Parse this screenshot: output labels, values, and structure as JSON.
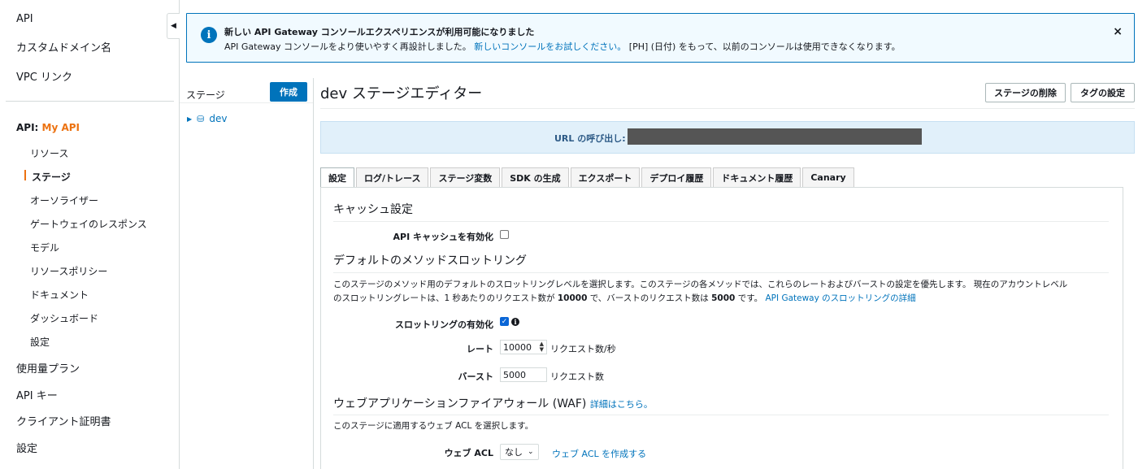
{
  "nav": {
    "top_items": [
      "API",
      "カスタムドメイン名",
      "VPC リンク"
    ],
    "api_prefix": "API: ",
    "api_name": "My API",
    "sub_items": [
      "リソース",
      "ステージ",
      "オーソライザー",
      "ゲートウェイのレスポンス",
      "モデル",
      "リソースポリシー",
      "ドキュメント",
      "ダッシュボード",
      "設定"
    ],
    "bottom_items": [
      "使用量プラン",
      "API キー",
      "クライアント証明書",
      "設定"
    ]
  },
  "banner": {
    "title": "新しい API Gateway コンソールエクスペリエンスが利用可能になりました",
    "text_before": "API Gateway コンソールをより使いやすく再設計しました。",
    "link": "新しいコンソールをお試しください。",
    "text_after": " [PH] (日付) をもって、以前のコンソールは使用できなくなります。",
    "close": "×"
  },
  "stages": {
    "label": "ステージ",
    "create_button": "作成",
    "items": [
      "dev"
    ]
  },
  "main": {
    "title": "dev ステージエディター",
    "delete_button": "ステージの削除",
    "tag_button": "タグの設定",
    "url_label": "URL の呼び出し:"
  },
  "tabs": [
    "設定",
    "ログ/トレース",
    "ステージ変数",
    "SDK の生成",
    "エクスポート",
    "デプロイ履歴",
    "ドキュメント履歴",
    "Canary"
  ],
  "cache": {
    "heading": "キャッシュ設定",
    "enable_label": "API キャッシュを有効化",
    "enabled": false
  },
  "throttling": {
    "heading": "デフォルトのメソッドスロットリング",
    "para_line1": "このステージのメソッド用のデフォルトのスロットリングレベルを選択します。このステージの各メソッドでは、これらのレートおよびバーストの設定を優先します。 現在のアカウントレベル",
    "para_l2_a": "のスロットリングレートは、1 秒あたりのリクエスト数が ",
    "para_l2_rate": "10000",
    "para_l2_b": " で、バーストのリクエスト数は ",
    "para_l2_burst": "5000",
    "para_l2_c": " です。",
    "para_link": "API Gateway のスロットリングの詳細",
    "enable_label": "スロットリングの有効化",
    "enabled": true,
    "rate_label": "レート",
    "rate_value": "10000",
    "rate_unit": "リクエスト数/秒",
    "burst_label": "バースト",
    "burst_value": "5000",
    "burst_unit": "リクエスト数"
  },
  "waf": {
    "heading": "ウェブアプリケーションファイアウォール (WAF)",
    "link": "詳細はこちら。",
    "para": "このステージに適用するウェブ ACL を選択します。",
    "acl_label": "ウェブ ACL",
    "acl_value": "なし",
    "create_link": "ウェブ ACL を作成する"
  }
}
